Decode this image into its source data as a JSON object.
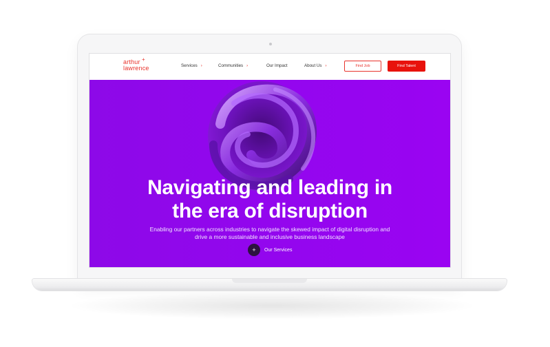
{
  "header": {
    "logo_line1": "arthur",
    "logo_line2": "lawrence",
    "logo_plus": "+",
    "nav": [
      {
        "label": "Services",
        "has_dropdown": true
      },
      {
        "label": "Communities",
        "has_dropdown": true
      },
      {
        "label": "Our Impact",
        "has_dropdown": false
      },
      {
        "label": "About Us",
        "has_dropdown": true
      }
    ],
    "dropdown_glyph": "›",
    "find_job_label": "Find Job",
    "find_talent_label": "Find Talent"
  },
  "hero": {
    "title_line1": "Navigating and leading in",
    "title_line2": "the era of disruption",
    "subtitle_line1": "Enabling our partners across industries to navigate the skewed impact of digital disruption and",
    "subtitle_line2": "drive a more sustainable and inclusive business landscape",
    "cta_label": "Our Services",
    "cta_icon": "plus-icon",
    "cta_glyph": "+"
  },
  "colors": {
    "brand_red": "#e8120c",
    "hero_purple": "#9306ee",
    "text_dark": "#333333",
    "white": "#ffffff"
  }
}
